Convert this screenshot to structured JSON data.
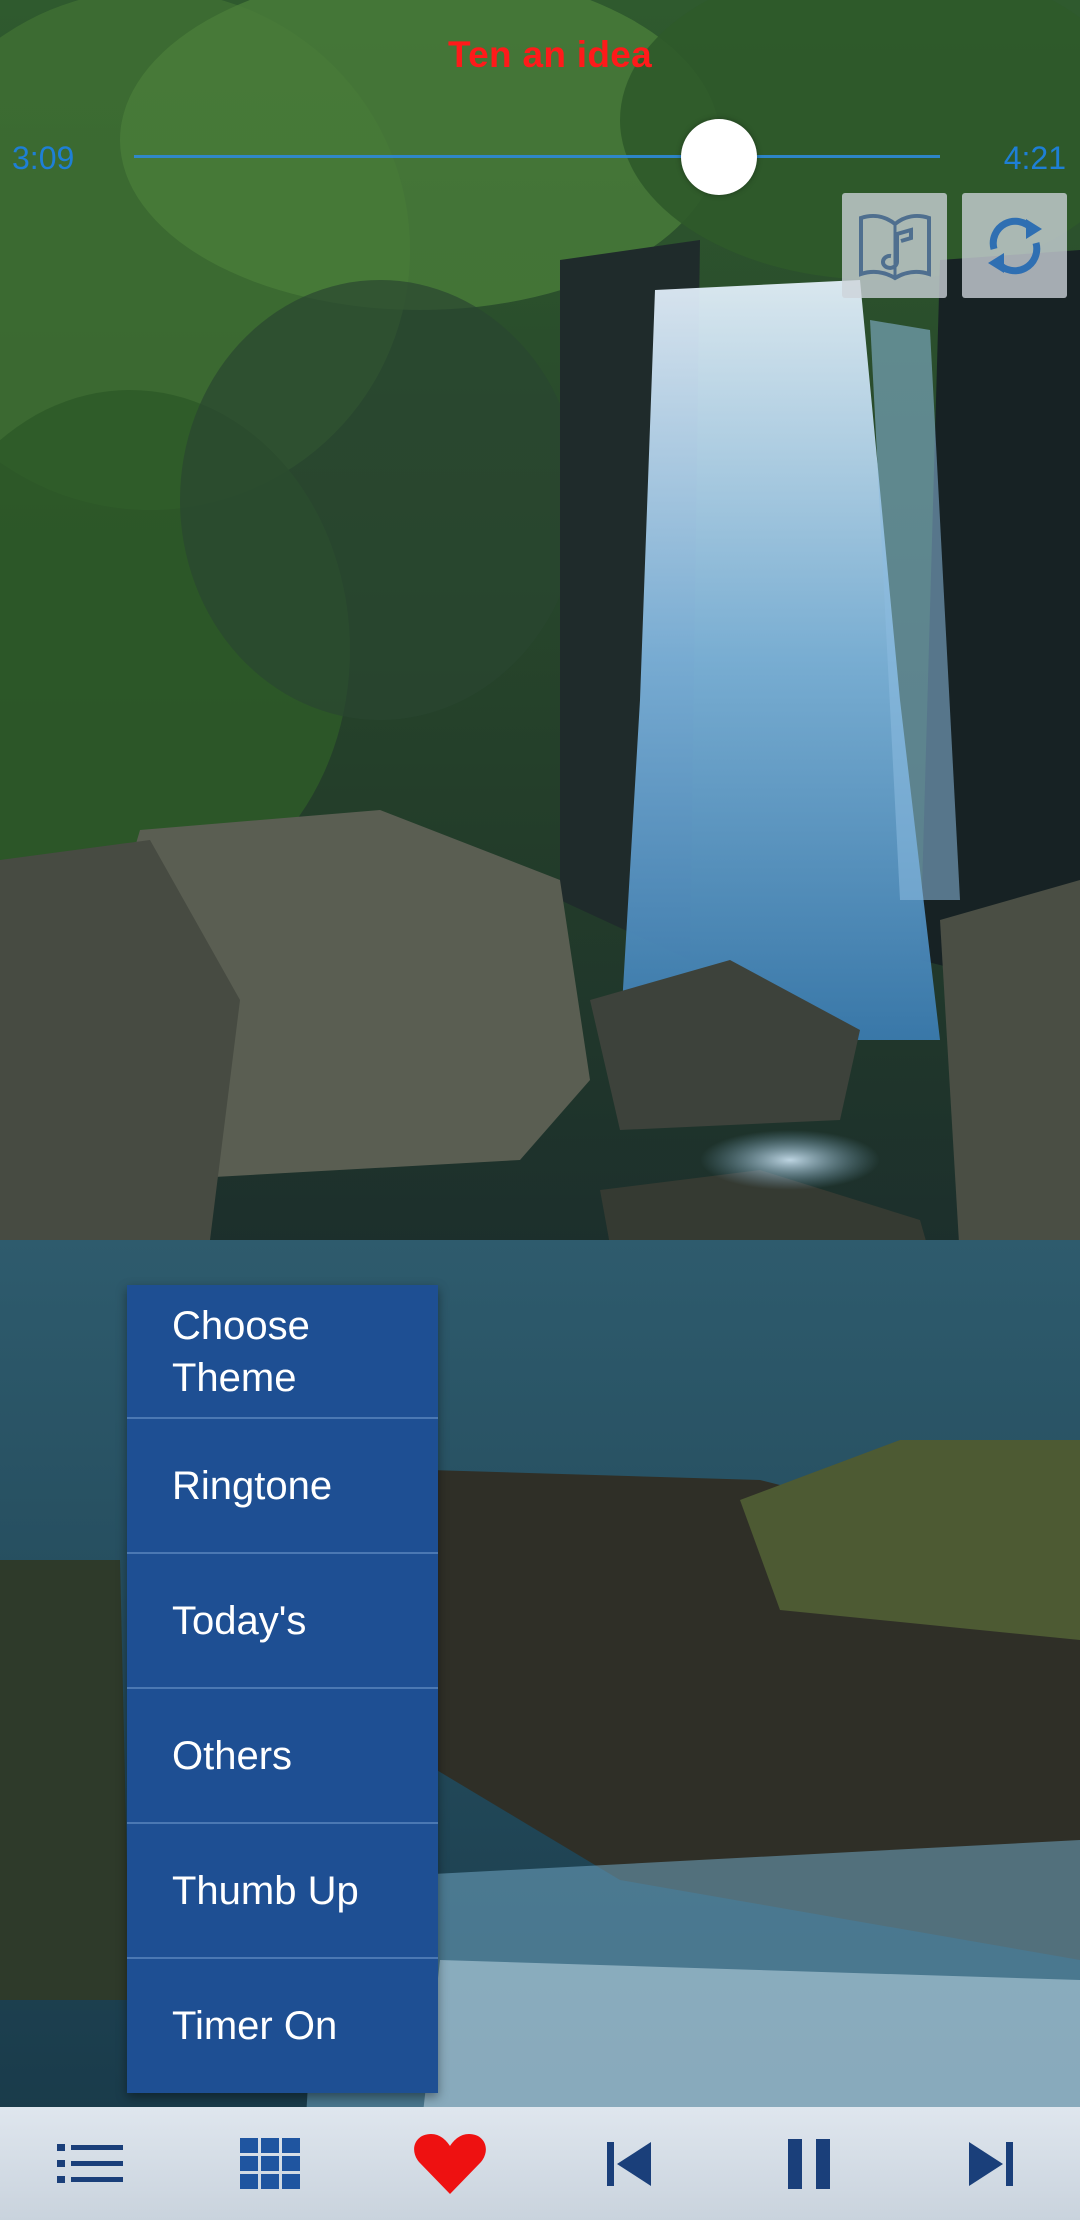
{
  "player": {
    "song_title": "Ten an idea",
    "elapsed": "3:09",
    "total": "4:21",
    "progress": 0.74
  },
  "top_buttons": [
    {
      "icon": "lyrics-book-icon"
    },
    {
      "icon": "repeat-icon"
    }
  ],
  "menu": {
    "items": [
      {
        "label": "Choose\nTheme"
      },
      {
        "label": "Ringtone"
      },
      {
        "label": "Today's"
      },
      {
        "label": "Others"
      },
      {
        "label": "Thumb Up"
      },
      {
        "label": "Timer On"
      }
    ]
  },
  "bottom_bar": {
    "buttons": [
      {
        "icon": "list-icon"
      },
      {
        "icon": "grid-icon"
      },
      {
        "icon": "heart-icon"
      },
      {
        "icon": "previous-icon"
      },
      {
        "icon": "pause-icon"
      },
      {
        "icon": "next-icon"
      }
    ]
  },
  "colors": {
    "accent": "#1e7fd6",
    "title": "#ff1a1a",
    "menu_bg": "#1e4f93",
    "heart": "#ee1111",
    "icon_dark": "#1a3f7a"
  }
}
